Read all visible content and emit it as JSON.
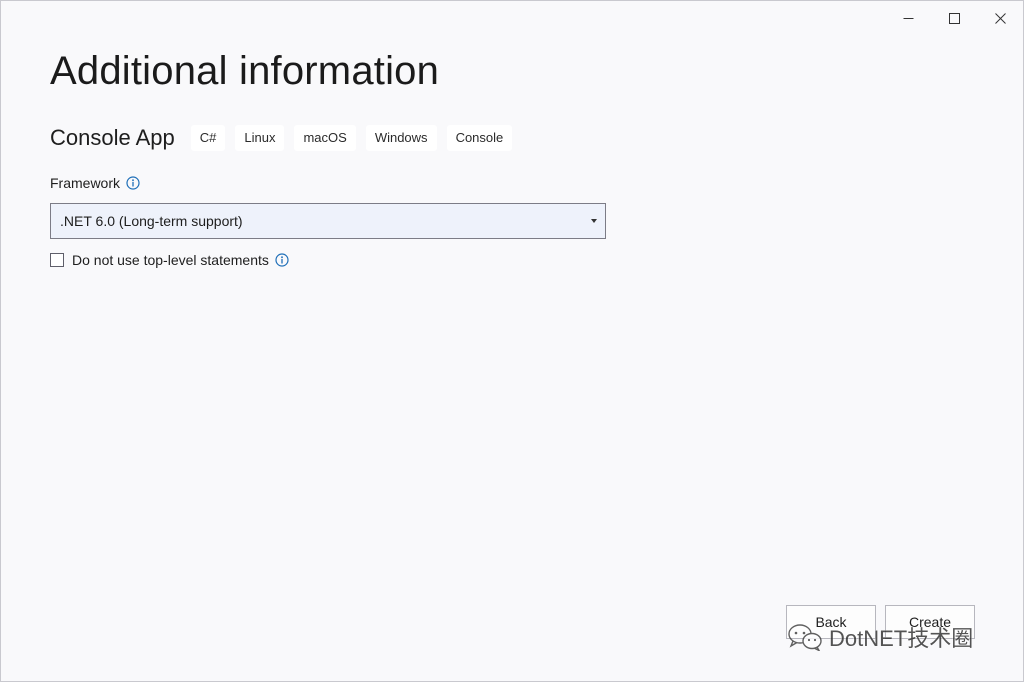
{
  "window": {
    "controls": {
      "minimize_icon": "minimize-icon",
      "maximize_icon": "maximize-icon",
      "close_icon": "close-icon"
    }
  },
  "page": {
    "title": "Additional information"
  },
  "template": {
    "name": "Console App",
    "tags": [
      "C#",
      "Linux",
      "macOS",
      "Windows",
      "Console"
    ]
  },
  "framework": {
    "label": "Framework",
    "selected": ".NET 6.0 (Long-term support)"
  },
  "top_level_statements": {
    "label": "Do not use top-level statements",
    "checked": false
  },
  "footer": {
    "back_label": "Back",
    "create_label": "Create"
  },
  "watermark": {
    "text": "DotNET技术圈"
  },
  "colors": {
    "background": "#f9f9fb",
    "info_icon": "#1f6fb8",
    "select_bg": "#eef2fb"
  }
}
